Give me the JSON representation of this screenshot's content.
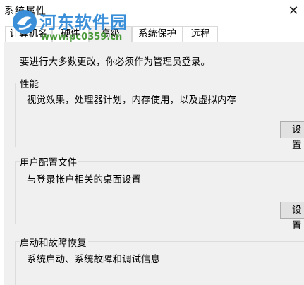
{
  "window": {
    "title": "系统属性",
    "close_glyph": "✕"
  },
  "watermark": {
    "name": "河东软件园",
    "url": "www.pc0359.cn"
  },
  "tabs": [
    {
      "label": "计算机名"
    },
    {
      "label": "硬件"
    },
    {
      "label": "高级"
    },
    {
      "label": "系统保护"
    },
    {
      "label": "远程"
    }
  ],
  "advanced": {
    "admin_note": "要进行大多数更改，你必须作为管理员登录。",
    "performance": {
      "title": "性能",
      "description": "视觉效果，处理器计划，内存使用，以及虚拟内存",
      "button_label": "设置"
    },
    "user_profiles": {
      "title": "用户配置文件",
      "description": "与登录帐户相关的桌面设置",
      "button_label": "设置"
    },
    "startup_recovery": {
      "title": "启动和故障恢复",
      "description": "系统启动、系统故障和调试信息"
    }
  },
  "colors": {
    "panel_bg": "#f0f0f0",
    "watermark_blue": "#3a8fd8",
    "watermark_green": "#4a9a3a"
  }
}
